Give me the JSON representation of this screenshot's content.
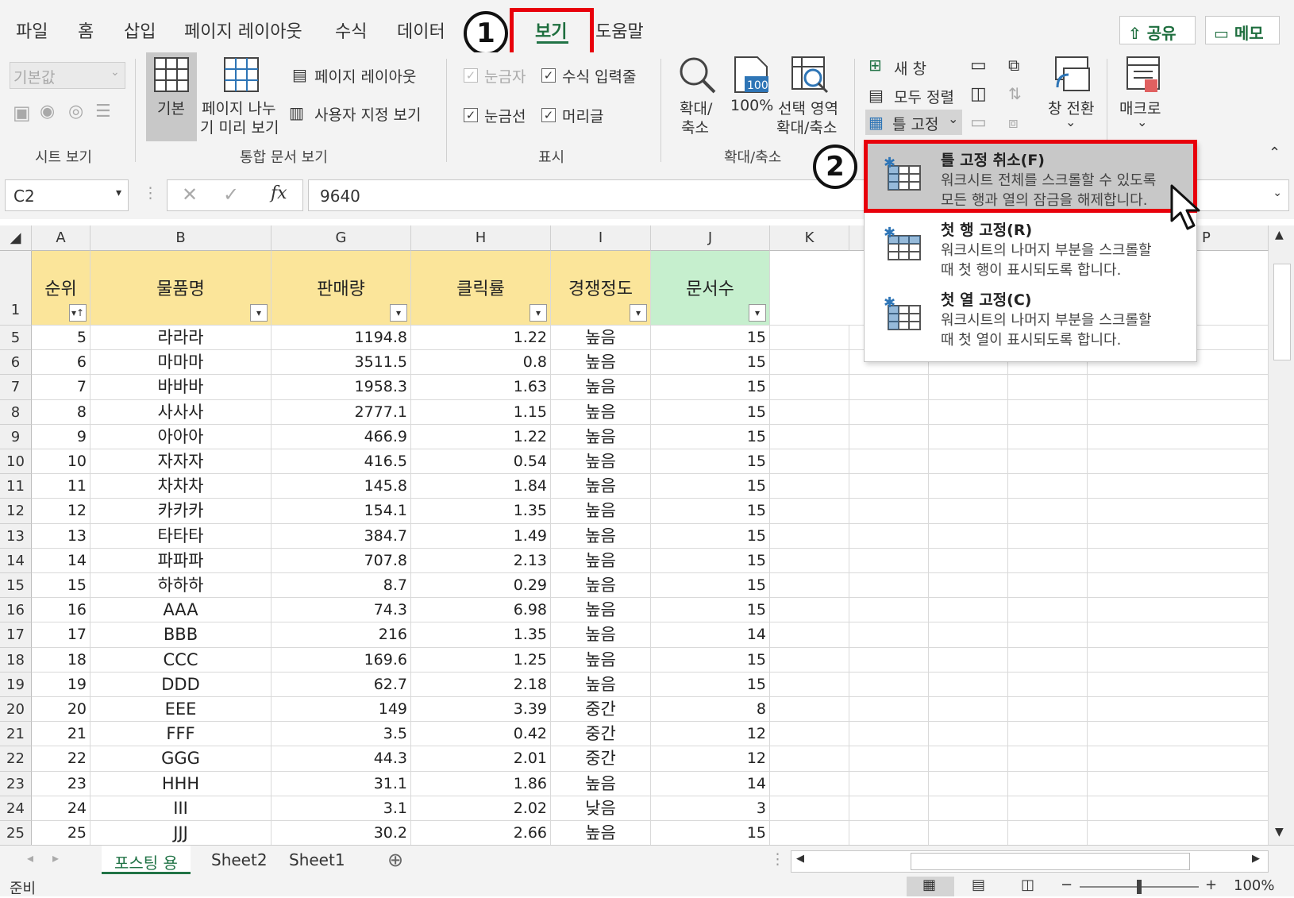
{
  "menu": {
    "tabs": [
      "파일",
      "홈",
      "삽입",
      "페이지 레이아웃",
      "수식",
      "데이터",
      "보기",
      "도움말"
    ],
    "share": "공유",
    "memo": "메모"
  },
  "steps": {
    "one": "1",
    "two": "2"
  },
  "ribbon": {
    "sheet_view": {
      "dropdown": "기본값",
      "label": "시트 보기"
    },
    "workbook_views": {
      "normal": "기본",
      "page_break_1": "페이지 나누",
      "page_break_2": "기 미리 보기",
      "page_layout": "페이지 레이아웃",
      "custom": "사용자 지정 보기",
      "label": "통합 문서 보기"
    },
    "show": {
      "ruler": "눈금자",
      "formula_bar": "수식 입력줄",
      "gridlines": "눈금선",
      "headings": "머리글",
      "label": "표시"
    },
    "zoom": {
      "zoom_1": "확대/",
      "zoom_2": "축소",
      "hundred": "100%",
      "sel_1": "선택 영역",
      "sel_2": "확대/축소",
      "label": "확대/축소"
    },
    "window": {
      "new_window": "새 창",
      "arrange_all": "모두 정렬",
      "freeze": "틀 고정",
      "switch": "창 전환"
    },
    "macros": "매크로"
  },
  "formula_bar": {
    "name_box": "C2",
    "value": "9640",
    "fx": "fx"
  },
  "grid": {
    "columns": [
      "A",
      "B",
      "G",
      "H",
      "I",
      "J",
      "K",
      "",
      "",
      "",
      "P"
    ],
    "header_row_num": "1",
    "headers": [
      "순위",
      "물품명",
      "판매량",
      "클릭률",
      "경쟁정도",
      "문서수"
    ],
    "rows": [
      [
        "5",
        "5",
        "라라라",
        "1194.8",
        "1.22",
        "높음",
        "15"
      ],
      [
        "6",
        "6",
        "마마마",
        "3511.5",
        "0.8",
        "높음",
        "15"
      ],
      [
        "7",
        "7",
        "바바바",
        "1958.3",
        "1.63",
        "높음",
        "15"
      ],
      [
        "8",
        "8",
        "사사사",
        "2777.1",
        "1.15",
        "높음",
        "15"
      ],
      [
        "9",
        "9",
        "아아아",
        "466.9",
        "1.22",
        "높음",
        "15"
      ],
      [
        "10",
        "10",
        "자자자",
        "416.5",
        "0.54",
        "높음",
        "15"
      ],
      [
        "11",
        "11",
        "차차차",
        "145.8",
        "1.84",
        "높음",
        "15"
      ],
      [
        "12",
        "12",
        "카카카",
        "154.1",
        "1.35",
        "높음",
        "15"
      ],
      [
        "13",
        "13",
        "타타타",
        "384.7",
        "1.49",
        "높음",
        "15"
      ],
      [
        "14",
        "14",
        "파파파",
        "707.8",
        "2.13",
        "높음",
        "15"
      ],
      [
        "15",
        "15",
        "하하하",
        "8.7",
        "0.29",
        "높음",
        "15"
      ],
      [
        "16",
        "16",
        "AAA",
        "74.3",
        "6.98",
        "높음",
        "15"
      ],
      [
        "17",
        "17",
        "BBB",
        "216",
        "1.35",
        "높음",
        "14"
      ],
      [
        "18",
        "18",
        "CCC",
        "169.6",
        "1.25",
        "높음",
        "15"
      ],
      [
        "19",
        "19",
        "DDD",
        "62.7",
        "2.18",
        "높음",
        "15"
      ],
      [
        "20",
        "20",
        "EEE",
        "149",
        "3.39",
        "중간",
        "8"
      ],
      [
        "21",
        "21",
        "FFF",
        "3.5",
        "0.42",
        "중간",
        "12"
      ],
      [
        "22",
        "22",
        "GGG",
        "44.3",
        "2.01",
        "중간",
        "12"
      ],
      [
        "23",
        "23",
        "HHH",
        "31.1",
        "1.86",
        "높음",
        "14"
      ],
      [
        "24",
        "24",
        "III",
        "3.1",
        "2.02",
        "낮음",
        "3"
      ],
      [
        "25",
        "25",
        "JJJ",
        "30.2",
        "2.66",
        "높음",
        "15"
      ]
    ]
  },
  "freeze_menu": [
    {
      "title": "틀 고정 취소(F)",
      "desc1": "워크시트 전체를 스크롤할 수 있도록",
      "desc2": "모든 행과 열의 잠금을 해제합니다."
    },
    {
      "title": "첫 행 고정(R)",
      "desc1": "워크시트의 나머지 부분을 스크롤할",
      "desc2": "때 첫 행이 표시되도록 합니다."
    },
    {
      "title": "첫 열 고정(C)",
      "desc1": "워크시트의 나머지 부분을 스크롤할",
      "desc2": "때 첫 열이 표시되도록 합니다."
    }
  ],
  "sheets": [
    "포스팅 용",
    "Sheet2",
    "Sheet1"
  ],
  "status": {
    "ready": "준비",
    "zoom": "100%"
  },
  "colors": {
    "accent": "#217346",
    "highlight": "#e8000b",
    "header_fill": "#fbe59a",
    "green_fill": "#c6efce"
  }
}
